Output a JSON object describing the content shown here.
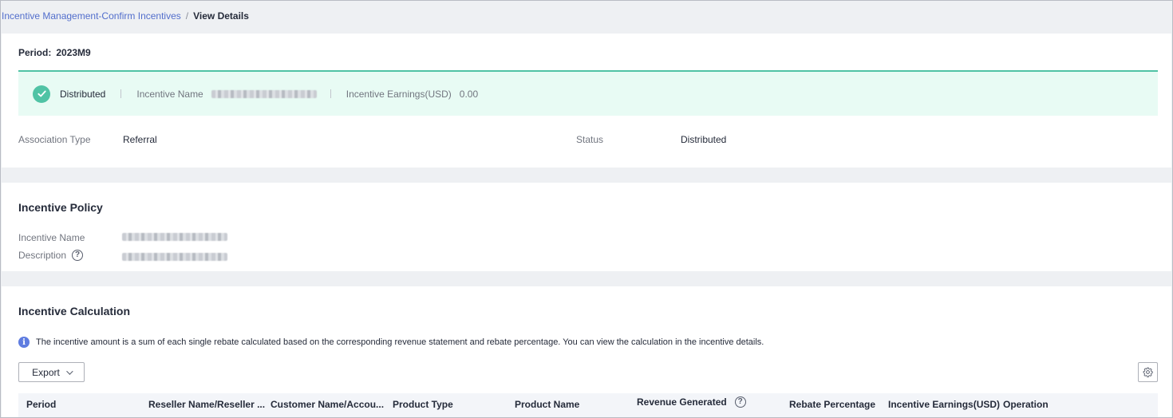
{
  "breadcrumb": {
    "parent": "Incentive Management-Confirm Incentives",
    "separator": "/",
    "current": "View Details"
  },
  "summary": {
    "period_label": "Period:",
    "period_value": "2023M9",
    "banner": {
      "status": "Distributed",
      "incentive_name_label": "Incentive Name",
      "earnings_label": "Incentive Earnings(USD)",
      "earnings_value": "0.00"
    },
    "association_type_label": "Association Type",
    "association_type_value": "Referral",
    "status_label": "Status",
    "status_value": "Distributed"
  },
  "policy": {
    "title": "Incentive Policy",
    "incentive_name_label": "Incentive Name",
    "description_label": "Description"
  },
  "calculation": {
    "title": "Incentive Calculation",
    "info": "The incentive amount is a sum of each single rebate calculated based on the corresponding revenue statement and rebate percentage. You can view the calculation in the incentive details.",
    "export_label": "Export",
    "columns": [
      "Period",
      "Reseller Name/Reseller ...",
      "Customer Name/Accou...",
      "Product Type",
      "Product Name",
      "Revenue Generated",
      "Rebate Percentage",
      "Incentive Earnings(USD)",
      "Operation"
    ]
  },
  "colors": {
    "success": "#50c3a5",
    "banner_bg": "#e8fbf4",
    "link": "#526ecc",
    "info": "#5e7ce0"
  },
  "icons": [
    "check-circle-icon",
    "help-icon",
    "info-icon",
    "chevron-down-icon",
    "gear-icon"
  ]
}
